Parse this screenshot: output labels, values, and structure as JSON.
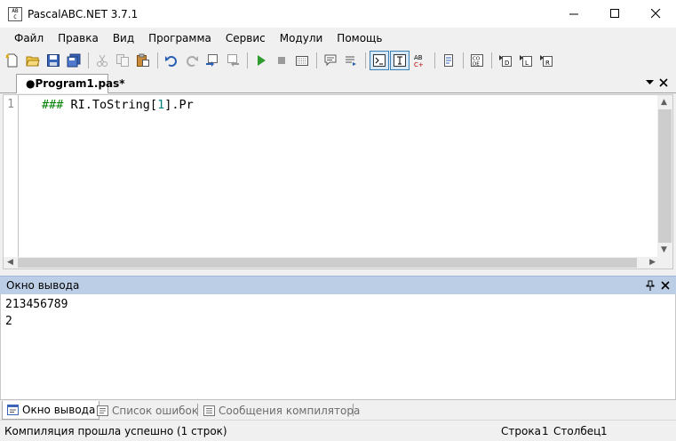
{
  "window": {
    "title": "PascalABC.NET 3.7.1",
    "icon_text": "AB C",
    "controls": [
      "minimize-icon",
      "maximize-icon",
      "close-icon"
    ]
  },
  "menu": {
    "items": [
      "Файл",
      "Правка",
      "Вид",
      "Программа",
      "Сервис",
      "Модули",
      "Помощь"
    ]
  },
  "toolbar": {
    "buttons": [
      "new-file-icon",
      "open-icon",
      "save-icon",
      "save-all-icon",
      "cut-icon",
      "copy-icon",
      "paste-icon",
      "undo-icon",
      "redo-icon",
      "indent-icon",
      "outdent-icon",
      "run-icon",
      "stop-icon",
      "compile-icon",
      "comment-icon",
      "uncomment-icon",
      "console-icon",
      "text-icon",
      "spell-icon",
      "format-icon",
      "code-icon",
      "debug-in-icon",
      "debug-out-icon",
      "debug-run-icon"
    ]
  },
  "editor": {
    "tab_label": "●Program1.pas*",
    "line_number": "1",
    "code_directive": "###",
    "code_prefix": " RI.ToString[",
    "code_number": "1",
    "code_suffix": "].Pr"
  },
  "output": {
    "title": "Окно вывода",
    "lines": [
      "213456789",
      "2"
    ]
  },
  "bottom_tabs": {
    "output": "Окно вывода",
    "errors": "Список ошибок",
    "compiler": "Сообщения компилятора"
  },
  "status": {
    "message": "Компиляция прошла успешно (1 строк)",
    "row_label": "Строка",
    "row_value": "1",
    "col_label": "Столбец",
    "col_value": "1"
  },
  "colors": {
    "directive": "#008000",
    "number": "#008080",
    "panel_header": "#bccee6",
    "pressed_button": "#d6e8f7"
  }
}
